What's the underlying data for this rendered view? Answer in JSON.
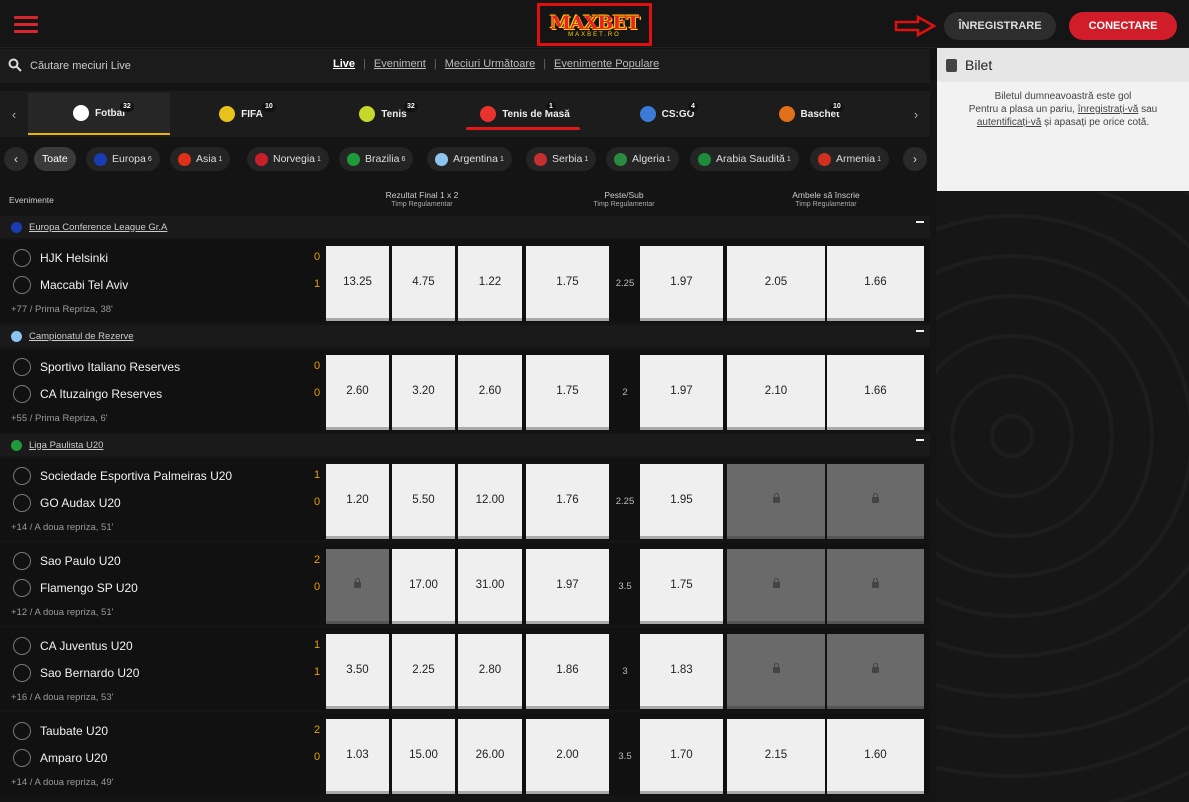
{
  "header": {
    "register_label": "ÎNREGISTRARE",
    "login_label": "CONECTARE",
    "logo_text": "MAXBET",
    "logo_sub": "MAXBET.RO"
  },
  "search": {
    "placeholder": "Căutare meciuri Live"
  },
  "live_nav": [
    {
      "label": "Live",
      "active": true
    },
    {
      "label": "Eveniment"
    },
    {
      "label": "Meciuri Următoare"
    },
    {
      "label": "Evenimente Populare"
    }
  ],
  "sports": [
    {
      "label": "Fotbal",
      "count": "32",
      "active": true,
      "icon": "soccer-ball-icon",
      "color": "#ffffff"
    },
    {
      "label": "FIFA",
      "count": "10",
      "icon": "fifa-icon",
      "color": "#e8c21a"
    },
    {
      "label": "Tenis",
      "count": "32",
      "icon": "tennis-ball-icon",
      "color": "#c8d82a"
    },
    {
      "label": "Tenis de Masă",
      "count": "1",
      "icon": "table-tennis-icon",
      "color": "#e8342c"
    },
    {
      "label": "CS:GO",
      "count": "4",
      "icon": "csgo-icon",
      "color": "#3b7bd6"
    },
    {
      "label": "Baschet",
      "count": "10",
      "icon": "basketball-icon",
      "color": "#e0701a"
    }
  ],
  "countries": [
    {
      "label": "Toate",
      "count": "",
      "active": true,
      "color": ""
    },
    {
      "label": "Europa",
      "count": "6",
      "color": "#1a3cb0"
    },
    {
      "label": "Asia",
      "count": "1",
      "color": "#e03018"
    },
    {
      "label": "Norvegia",
      "count": "1",
      "color": "#c8202a"
    },
    {
      "label": "Brazilia",
      "count": "6",
      "color": "#1f9a3a"
    },
    {
      "label": "Argentina",
      "count": "1",
      "color": "#8cc4ee"
    },
    {
      "label": "Serbia",
      "count": "1",
      "color": "#c43030"
    },
    {
      "label": "Algeria",
      "count": "1",
      "color": "#2a8a40"
    },
    {
      "label": "Arabia Saudită",
      "count": "1",
      "color": "#1c8c3a"
    },
    {
      "label": "Armenia",
      "count": "1",
      "color": "#d03020"
    }
  ],
  "columns": {
    "events": "Evenimente",
    "result": "Rezultat Final 1 x 2",
    "result_sub": "Timp Regulamentar",
    "ou": "Peste/Sub",
    "ou_sub": "Timp Regulamentar",
    "btts": "Ambele să înscrie",
    "btts_sub": "Timp Regulamentar"
  },
  "leagues": [
    {
      "name": "Europa Conference League Gr.A",
      "color": "#1a3cb0",
      "matches": [
        {
          "home": "HJK Helsinki",
          "away": "Maccabi Tel Aviv",
          "home_score": "0",
          "away_score": "1",
          "info": "+77 / Prima Repriza, 38'",
          "odds": [
            "13.25",
            "4.75",
            "1.22",
            "1.75",
            "2.25",
            "1.97",
            "2.05",
            "1.66"
          ]
        }
      ]
    },
    {
      "name": "Campionatul de Rezerve",
      "color": "#8cc4ee",
      "matches": [
        {
          "home": "Sportivo Italiano Reserves",
          "away": "CA Ituzaingo Reserves",
          "home_score": "0",
          "away_score": "0",
          "info": "+55 / Prima Repriza, 6'",
          "odds": [
            "2.60",
            "3.20",
            "2.60",
            "1.75",
            "2",
            "1.97",
            "2.10",
            "1.66"
          ]
        }
      ]
    },
    {
      "name": "Liga Paulista U20",
      "color": "#1f9a3a",
      "matches": [
        {
          "home": "Sociedade Esportiva Palmeiras U20",
          "away": "GO Audax U20",
          "home_score": "1",
          "away_score": "0",
          "info": "+14 / A doua repriza, 51'",
          "odds": [
            "1.20",
            "5.50",
            "12.00",
            "1.76",
            "2.25",
            "1.95",
            "",
            ""
          ]
        },
        {
          "home": "Sao Paulo U20",
          "away": "Flamengo SP U20",
          "home_score": "2",
          "away_score": "0",
          "info": "+12 / A doua repriza, 51'",
          "odds": [
            "",
            "17.00",
            "31.00",
            "1.97",
            "3.5",
            "1.75",
            "",
            ""
          ]
        },
        {
          "home": "CA Juventus U20",
          "away": "Sao Bernardo U20",
          "home_score": "1",
          "away_score": "1",
          "info": "+16 / A doua repriza, 53'",
          "odds": [
            "3.50",
            "2.25",
            "2.80",
            "1.86",
            "3",
            "1.83",
            "",
            ""
          ]
        },
        {
          "home": "Taubate U20",
          "away": "Amparo U20",
          "home_score": "2",
          "away_score": "0",
          "info": "+14 / A doua repriza, 49'",
          "odds": [
            "1.03",
            "15.00",
            "26.00",
            "2.00",
            "3.5",
            "1.70",
            "2.15",
            "1.60"
          ]
        }
      ]
    }
  ],
  "ticket": {
    "title": "Bilet",
    "line1": "Biletul dumneavoastră este gol",
    "line2a": "Pentru a plasa un pariu, ",
    "link1": "înregistrați-vă",
    "line2b": " sau",
    "link2": "autentificați-vă",
    "line3": " și apasați pe orice cotă."
  }
}
